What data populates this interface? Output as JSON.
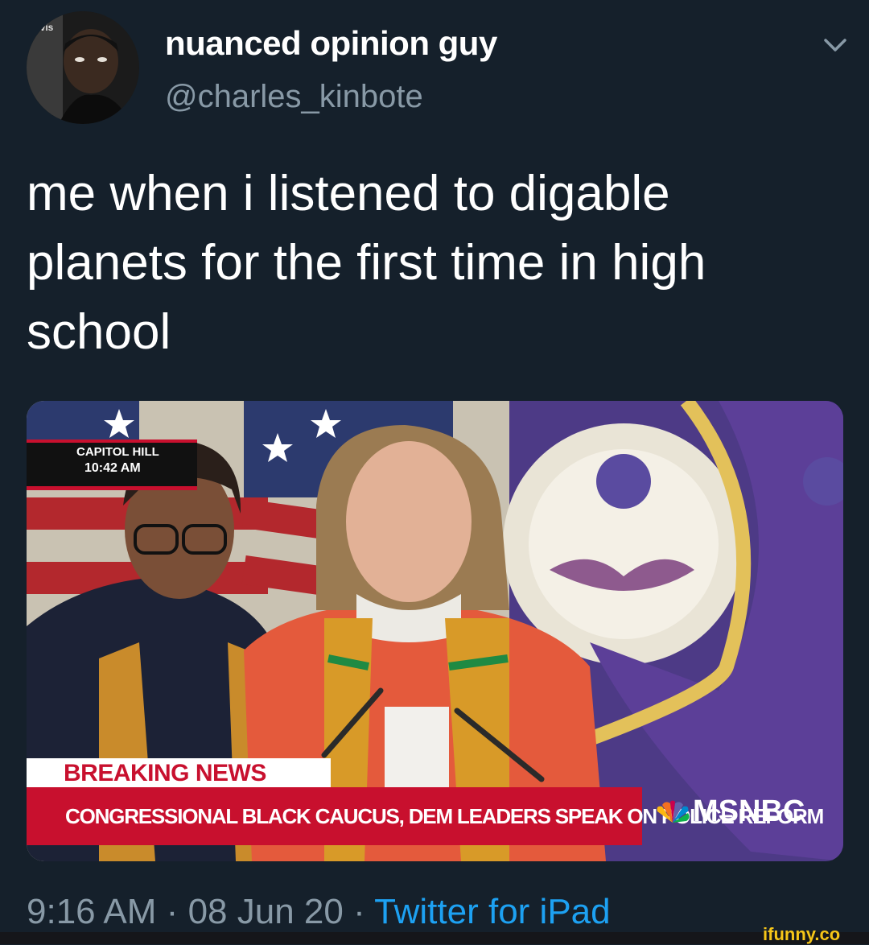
{
  "author": {
    "display_name": "nuanced opinion guy",
    "handle": "@charles_kinbote",
    "avatar_badge": "avis"
  },
  "tweet": {
    "text": "me when i listened to digable planets for the first time in high school"
  },
  "media": {
    "location_line1": "CAPITOL HILL",
    "location_line2": "10:42 AM",
    "breaking_label": "BREAKING NEWS",
    "headline": "CONGRESSIONAL BLACK CAUCUS, DEM LEADERS SPEAK ON POLICE REFORM",
    "network": "MSNBC"
  },
  "meta": {
    "time": "9:16 AM",
    "separator": "·",
    "date": "08 Jun 20",
    "source": "Twitter for iPad"
  },
  "watermark": "ifunny.co",
  "colors": {
    "background": "#15202b",
    "secondary_text": "#8899a6",
    "link": "#1da1f2",
    "news_red": "#c8102e"
  },
  "icons": {
    "menu": "chevron-down-icon",
    "network_logo": "peacock-icon"
  }
}
